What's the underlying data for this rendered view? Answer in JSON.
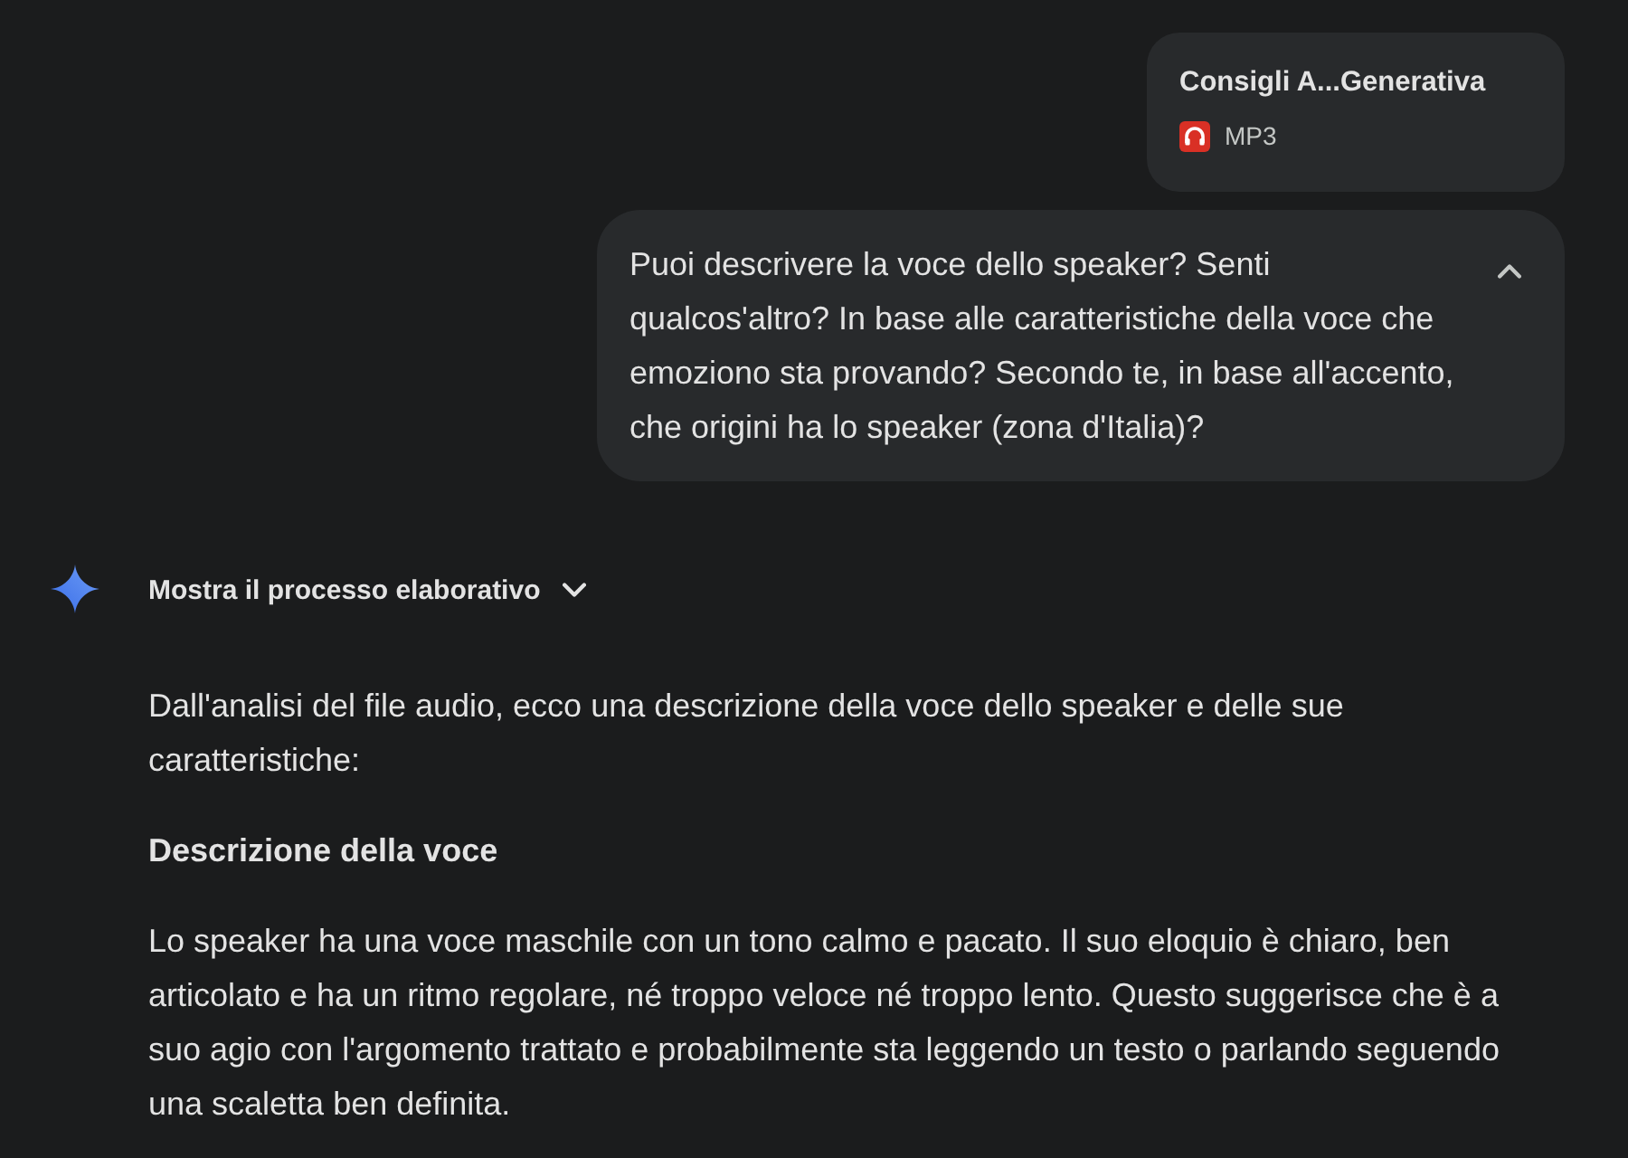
{
  "attachment": {
    "file_name": "Consigli A...Generativa",
    "file_type": "MP3"
  },
  "prompt": {
    "text": "Puoi descrivere la voce dello speaker? Senti qualcos'altro? In base alle caratteristiche della voce che emoziono sta provando? Secondo te, in base all'accento, che origini ha lo speaker (zona d'Italia)?",
    "expanded": true
  },
  "response": {
    "thinking_toggle": {
      "label": "Mostra il processo elaborativo",
      "expanded": false
    },
    "blocks": [
      {
        "kind": "paragraph",
        "text": "Dall'analisi del file audio, ecco una descrizione della voce dello speaker e delle sue caratteristiche:"
      },
      {
        "kind": "heading",
        "text": "Descrizione della voce"
      },
      {
        "kind": "paragraph",
        "text": "Lo speaker ha una voce maschile con un tono calmo e pacato. Il suo eloquio è chiaro, ben articolato e ha un ritmo regolare, né troppo veloce né troppo lento. Questo suggerisce che è a suo agio con l'argomento trattato e probabilmente sta leggendo un testo o parlando seguendo una scaletta ben definita."
      }
    ]
  }
}
